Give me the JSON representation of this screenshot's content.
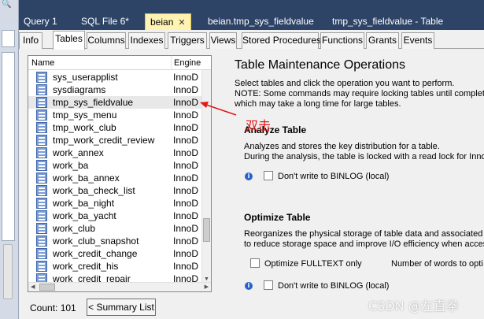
{
  "doc_tabs": [
    {
      "label": "Query 1"
    },
    {
      "label": "SQL File 6*"
    },
    {
      "label": "beian",
      "active": true
    },
    {
      "label": "beian.tmp_sys_fieldvalue"
    },
    {
      "label": "tmp_sys_fieldvalue - Table"
    }
  ],
  "sub_tabs": [
    {
      "label": "Info"
    },
    {
      "label": "Tables",
      "active": true
    },
    {
      "label": "Columns"
    },
    {
      "label": "Indexes"
    },
    {
      "label": "Triggers"
    },
    {
      "label": "Views"
    },
    {
      "label": "Stored Procedures"
    },
    {
      "label": "Functions"
    },
    {
      "label": "Grants"
    },
    {
      "label": "Events"
    }
  ],
  "tables_list": {
    "headers": {
      "name": "Name",
      "engine": "Engine"
    },
    "rows": [
      {
        "name": "sys_userapplist",
        "engine": "InnoD"
      },
      {
        "name": "sysdiagrams",
        "engine": "InnoD"
      },
      {
        "name": "tmp_sys_fieldvalue",
        "engine": "InnoD",
        "selected": true
      },
      {
        "name": "tmp_sys_menu",
        "engine": "InnoD"
      },
      {
        "name": "tmp_work_club",
        "engine": "InnoD"
      },
      {
        "name": "tmp_work_credit_review",
        "engine": "InnoD"
      },
      {
        "name": "work_annex",
        "engine": "InnoD"
      },
      {
        "name": "work_ba",
        "engine": "InnoD"
      },
      {
        "name": "work_ba_annex",
        "engine": "InnoD"
      },
      {
        "name": "work_ba_check_list",
        "engine": "InnoD"
      },
      {
        "name": "work_ba_night",
        "engine": "InnoD"
      },
      {
        "name": "work_ba_yacht",
        "engine": "InnoD"
      },
      {
        "name": "work_club",
        "engine": "InnoD"
      },
      {
        "name": "work_club_snapshot",
        "engine": "InnoD"
      },
      {
        "name": "work_credit_change",
        "engine": "InnoD"
      },
      {
        "name": "work_credit_his",
        "engine": "InnoD"
      },
      {
        "name": "work_credit_repair",
        "engine": "InnoD"
      }
    ],
    "count_label": "Count: 101",
    "summary_button": "< Summary List"
  },
  "maintenance": {
    "title": "Table Maintenance Operations",
    "desc_line1": "Select tables and click the operation you want to perform.",
    "desc_line2": "NOTE: Some commands may require locking tables until completion",
    "desc_line3": "which may take a long time for large tables.",
    "analyze": {
      "title": "Analyze Table",
      "desc1": "Analyzes and stores the key distribution for a table.",
      "desc2": "During the analysis, the table is locked with a read lock for Inno",
      "no_binlog": "Don't write to BINLOG (local)"
    },
    "optimize": {
      "title": "Optimize Table",
      "desc1": "Reorganizes the physical storage of table data and associated i",
      "desc2": "to reduce storage space and improve I/O efficiency when acces",
      "fulltext": "Optimize FULLTEXT only",
      "words": "Number of words to opti",
      "no_binlog": "Don't write to BINLOG (local)"
    }
  },
  "annotation": {
    "text": "双击",
    "color": "#e01818"
  },
  "watermark": "CSDN @左直拳",
  "colors": {
    "tab_bar": "#2e4467",
    "active_tab": "#fff3b3",
    "panel_bg": "#f0f0f0"
  }
}
